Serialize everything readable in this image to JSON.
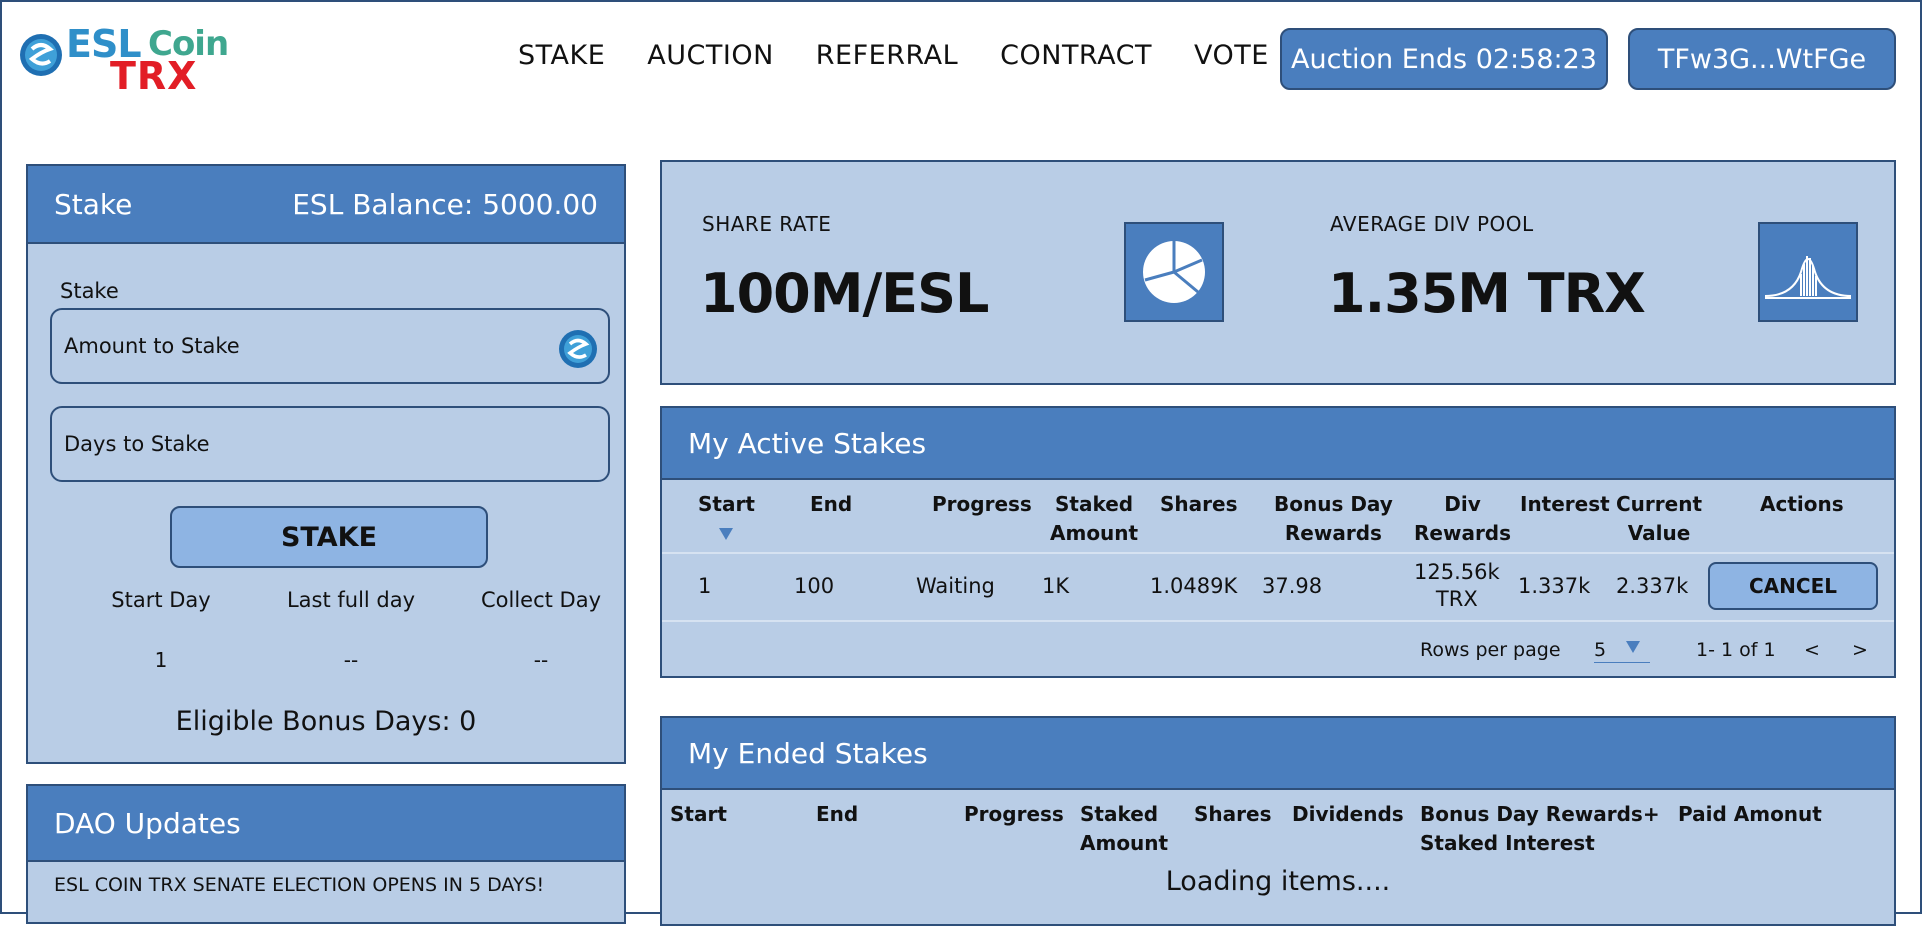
{
  "brand": {
    "word1": "ESL",
    "word2": "Coin",
    "word3": "TRX"
  },
  "nav": [
    "STAKE",
    "AUCTION",
    "REFERRAL",
    "CONTRACT",
    "VOTE"
  ],
  "header": {
    "auction_label": "Auction Ends 02:58:23",
    "wallet": "TFw3G...WtFGe"
  },
  "stake_panel": {
    "title": "Stake",
    "balance": "ESL Balance: 5000.00",
    "field_label": "Stake",
    "amount_placeholder": "Amount to Stake",
    "days_placeholder": "Days to Stake",
    "button": "STAKE",
    "start_day_label": "Start Day",
    "last_full_day_label": "Last full day",
    "collect_day_label": "Collect Day",
    "start_day": "1",
    "last_full_day": "--",
    "collect_day": "--",
    "eligible": "Eligible Bonus Days: 0"
  },
  "dao": {
    "title": "DAO Updates",
    "message": "ESL COIN TRX SENATE ELECTION OPENS IN 5 DAYS!"
  },
  "stats": {
    "share_rate_label": "SHARE RATE",
    "share_rate_value": "100M/ESL",
    "avg_div_label": "AVERAGE DIV POOL",
    "avg_div_value": "1.35M TRX",
    "icons": [
      "pie-chart-icon",
      "bell-curve-icon"
    ]
  },
  "active_stakes": {
    "title": "My Active Stakes",
    "headers": {
      "start": "Start",
      "end": "End",
      "progress": "Progress",
      "staked_1": "Staked",
      "staked_2": "Amount",
      "shares": "Shares",
      "bonus_1": "Bonus Day",
      "bonus_2": "Rewards",
      "div_1": "Div",
      "div_2": "Rewards",
      "interest": "Interest",
      "current_1": "Current",
      "current_2": "Value",
      "actions": "Actions"
    },
    "rows": [
      {
        "start": "1",
        "end": "100",
        "progress": "Waiting",
        "staked": "1K",
        "shares": "1.0489K",
        "bonus": "37.98",
        "div_1": "125.56k",
        "div_2": "TRX",
        "interest": "1.337k",
        "current": "2.337k",
        "action": "CANCEL"
      }
    ],
    "pager": {
      "rows_label": "Rows per page",
      "rows_value": "5",
      "range": "1- 1 of 1",
      "prev": "<",
      "next": ">"
    }
  },
  "ended_stakes": {
    "title": "My Ended Stakes",
    "headers": {
      "start": "Start",
      "end": "End",
      "progress": "Progress",
      "staked_1": "Staked",
      "staked_2": "Amount",
      "shares": "Shares",
      "dividends": "Dividends",
      "bonus_1": "Bonus Day Rewards+",
      "bonus_2": "Staked Interest",
      "paid": "Paid Amonut"
    },
    "loading": "Loading items...."
  },
  "colors": {
    "header_blue": "#4a7ebe",
    "panel_bg": "#b9cde6",
    "border": "#2e4f7a",
    "button_light": "#8eb4e3"
  }
}
